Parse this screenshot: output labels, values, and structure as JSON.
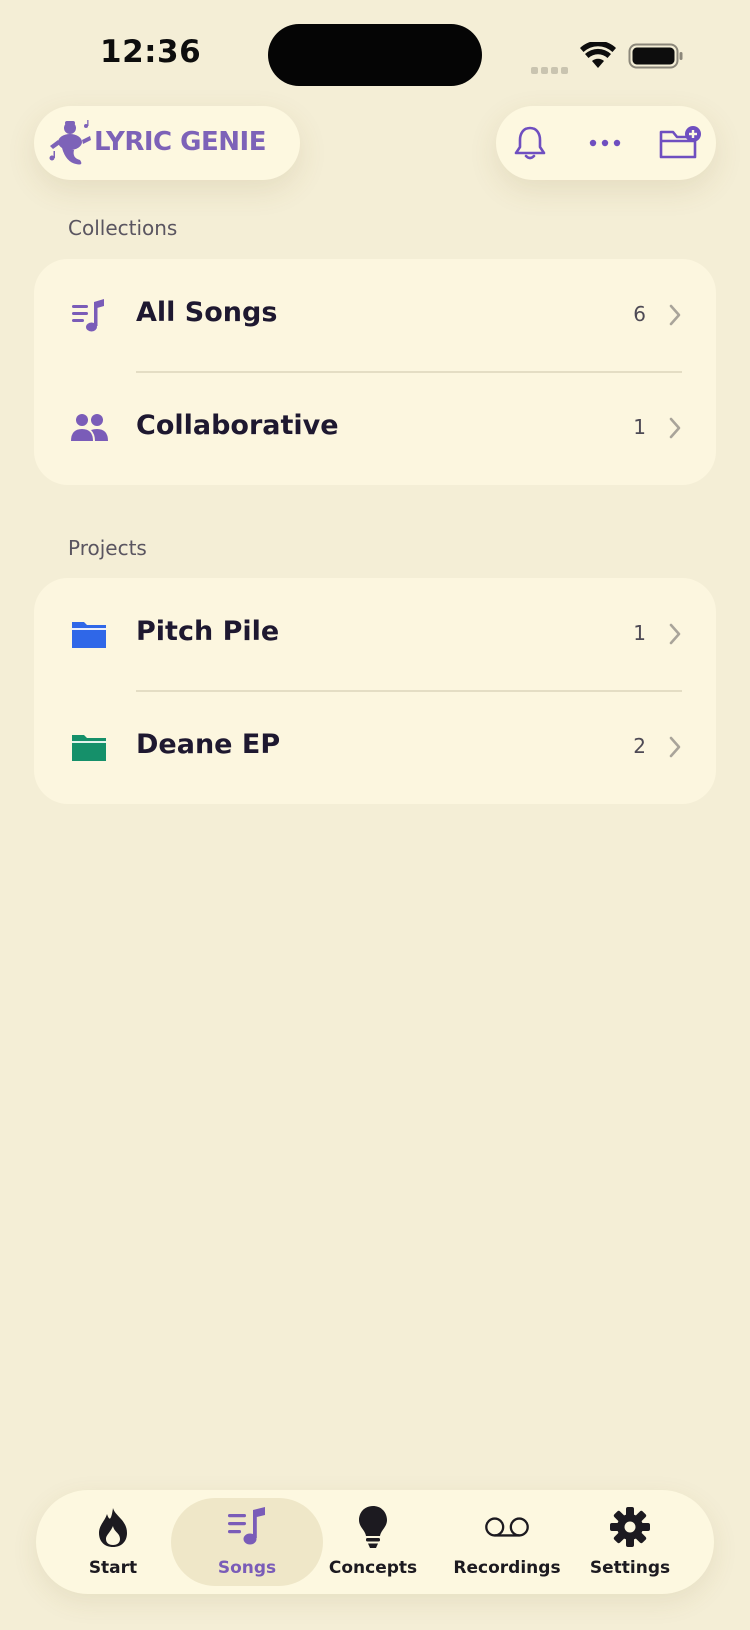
{
  "status_bar": {
    "time": "12:36"
  },
  "header": {
    "logo_text": "LYRIC GENIE",
    "actions": [
      "bell-icon",
      "more-icon",
      "new-folder-icon"
    ]
  },
  "sections": {
    "collections": {
      "label": "Collections",
      "items": [
        {
          "label": "All Songs",
          "count": "6",
          "icon": "music-list-icon"
        },
        {
          "label": "Collaborative",
          "count": "1",
          "icon": "people-icon"
        }
      ]
    },
    "projects": {
      "label": "Projects",
      "items": [
        {
          "label": "Pitch Pile",
          "count": "1",
          "icon": "folder-icon",
          "color": "#2f67e8"
        },
        {
          "label": "Deane EP",
          "count": "2",
          "icon": "folder-icon",
          "color": "#15906a"
        }
      ]
    }
  },
  "tabbar": {
    "tabs": [
      {
        "label": "Start",
        "icon": "flame-icon"
      },
      {
        "label": "Songs",
        "icon": "music-list-icon",
        "active": true
      },
      {
        "label": "Concepts",
        "icon": "lightbulb-icon"
      },
      {
        "label": "Recordings",
        "icon": "voicemail-icon"
      },
      {
        "label": "Settings",
        "icon": "gear-icon"
      }
    ]
  },
  "colors": {
    "background": "#f4eed6",
    "card": "#fcf6df",
    "accent": "#7a5cb8"
  }
}
